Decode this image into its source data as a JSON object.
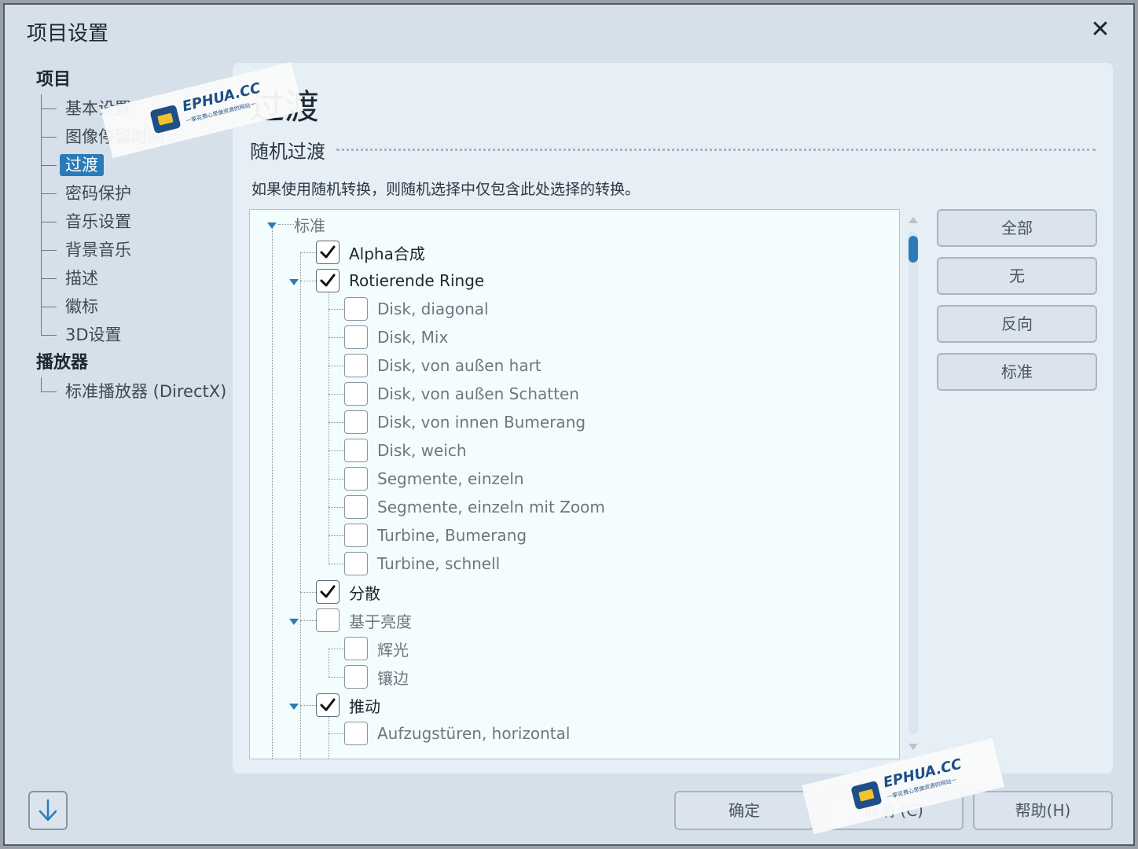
{
  "window": {
    "title": "项目设置",
    "close_symbol": "✕"
  },
  "sidebar": {
    "group1": "项目",
    "items": [
      {
        "label": "基本设置"
      },
      {
        "label": "图像停留时间"
      },
      {
        "label": "过渡",
        "active": true
      },
      {
        "label": "密码保护"
      },
      {
        "label": "音乐设置"
      },
      {
        "label": "背景音乐"
      },
      {
        "label": "描述"
      },
      {
        "label": "徽标"
      },
      {
        "label": "3D设置"
      }
    ],
    "group2": "播放器",
    "items2": [
      {
        "label": "标准播放器 (DirectX)"
      }
    ]
  },
  "main": {
    "page_title": "过渡",
    "section_title": "随机过渡",
    "description": "如果使用随机转换，则随机选择中仅包含此处选择的转换。",
    "tree": [
      {
        "label": "标准",
        "level": 0,
        "checkbox": false,
        "expanded": true
      },
      {
        "label": "Alpha合成",
        "level": 1,
        "checked": true
      },
      {
        "label": "Rotierende Ringe",
        "level": 1,
        "checked": true,
        "expanded": true
      },
      {
        "label": "Disk, diagonal",
        "level": 2,
        "checked": false
      },
      {
        "label": "Disk, Mix",
        "level": 2,
        "checked": false
      },
      {
        "label": "Disk, von außen hart",
        "level": 2,
        "checked": false
      },
      {
        "label": "Disk, von außen Schatten",
        "level": 2,
        "checked": false
      },
      {
        "label": "Disk, von innen Bumerang",
        "level": 2,
        "checked": false
      },
      {
        "label": "Disk, weich",
        "level": 2,
        "checked": false
      },
      {
        "label": "Segmente, einzeln",
        "level": 2,
        "checked": false
      },
      {
        "label": "Segmente, einzeln mit Zoom",
        "level": 2,
        "checked": false
      },
      {
        "label": "Turbine, Bumerang",
        "level": 2,
        "checked": false
      },
      {
        "label": "Turbine, schnell",
        "level": 2,
        "checked": false
      },
      {
        "label": "分散",
        "level": 1,
        "checked": true
      },
      {
        "label": "基于亮度",
        "level": 1,
        "checked": false,
        "expanded": true
      },
      {
        "label": "辉光",
        "level": 2,
        "checked": false
      },
      {
        "label": "镶边",
        "level": 2,
        "checked": false
      },
      {
        "label": "推动",
        "level": 1,
        "checked": true,
        "expanded": true
      },
      {
        "label": "Aufzugstüren, horizontal",
        "level": 2,
        "checked": false
      }
    ]
  },
  "side_buttons": {
    "all": "全部",
    "none": "无",
    "invert": "反向",
    "standard": "标准"
  },
  "footer": {
    "ok": "确定",
    "cancel": "取消 (C)",
    "help": "帮助(H)"
  },
  "watermark": {
    "brand": "EPHUA.CC",
    "tagline": "一家花费心思做资源的网站一"
  },
  "colors": {
    "accent": "#2b7bb8",
    "dialog_bg": "#d6e0ea",
    "panel_bg": "#e6eef6",
    "tree_bg": "#f4fdfd"
  }
}
